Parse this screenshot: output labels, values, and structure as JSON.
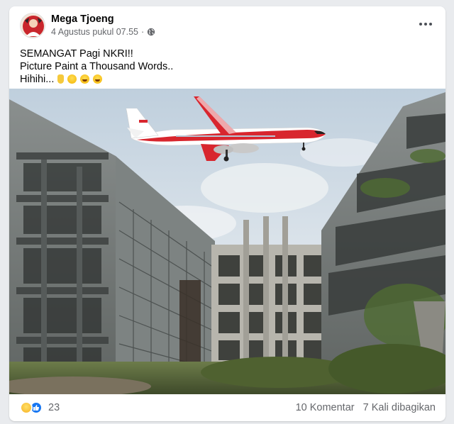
{
  "post": {
    "author": "Mega Tjoeng",
    "timestamp": "4 Agustus pukul 07.55",
    "separator": "·",
    "privacy_icon": "globe-icon",
    "more_icon": "more-options-icon",
    "text_lines": [
      "SEMANGAT Pagi NKRI!!",
      "Picture Paint a Thousand Words..",
      "Hihihi..."
    ],
    "text_emojis": [
      "pointing-up-emoji",
      "smirk-emoji",
      "laughing-emoji",
      "laughing-emoji"
    ]
  },
  "image": {
    "subject": "Airliner with red-white livery flying low over abandoned concrete buildings",
    "plane_colors": {
      "body": "#ffffff",
      "stripe": "#d8262e",
      "tail": "#d8262e"
    },
    "sky_color": "#cfdbe6"
  },
  "footer": {
    "reaction_icons": [
      "haha-reaction-icon",
      "like-reaction-icon"
    ],
    "reaction_count": "23",
    "comments": "10 Komentar",
    "shares": "7 Kali dibagikan"
  },
  "colors": {
    "background": "#e9ebee",
    "card": "#ffffff",
    "secondary_text": "#65676b",
    "like_blue": "#1877f2"
  }
}
